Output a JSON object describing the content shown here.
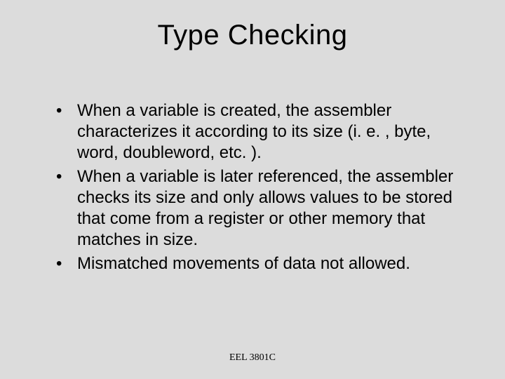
{
  "slide": {
    "title": "Type Checking",
    "bullets": [
      "When a variable is created, the assembler characterizes it according to its size (i. e. , byte, word, doubleword, etc. ).",
      "When a variable is later referenced, the assembler checks its size and only allows values to be stored that come from a register or other memory that matches in size.",
      "Mismatched movements of data not allowed."
    ],
    "footer": "EEL 3801C"
  }
}
